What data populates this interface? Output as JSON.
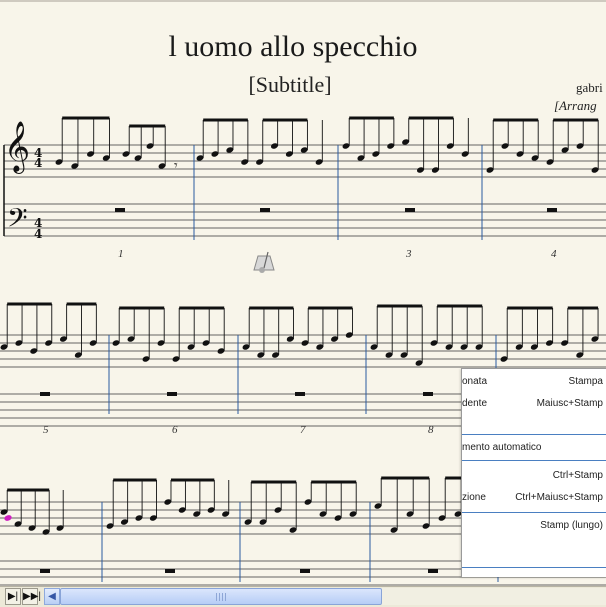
{
  "score": {
    "title": "l uomo allo specchio",
    "subtitle": "[Subtitle]",
    "composer": "gabri",
    "arranger": "[Arrang"
  },
  "measure_numbers": [
    "1",
    "3",
    "4",
    "5",
    "6",
    "7",
    "8"
  ],
  "context_menu": {
    "items": [
      {
        "label": "onata",
        "shortcut": "Stampa"
      },
      {
        "label": "dente",
        "shortcut": "Maiusc+Stamp"
      },
      {
        "label": "mento automatico",
        "shortcut": ""
      },
      {
        "label": "",
        "shortcut": "Ctrl+Stamp"
      },
      {
        "label": "zione",
        "shortcut": "Ctrl+Maiusc+Stamp"
      },
      {
        "label": "",
        "shortcut": "Stamp (lungo)"
      }
    ]
  },
  "scrollbar": {
    "first_page_glyph": "▶|",
    "last_page_glyph": "▶▶|",
    "left_arrow_glyph": "◀"
  },
  "colors": {
    "paper": "#f8f5ea",
    "barline_blue": "#2a5aa0",
    "selected_note": "#d020c0",
    "menu_separator": "#4a7fc1"
  }
}
